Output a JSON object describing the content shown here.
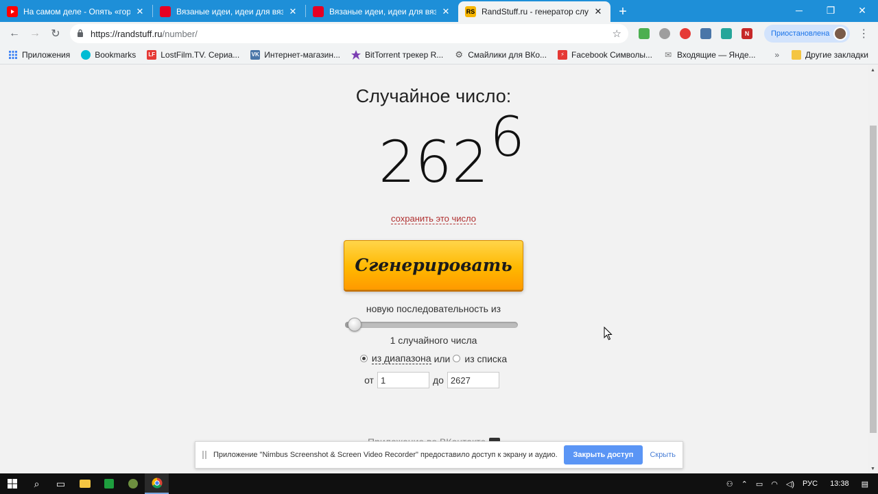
{
  "browser": {
    "tabs": [
      {
        "title": "На самом деле - Опять «гор",
        "favicon": "youtube-icon",
        "color": "#ff0000",
        "active": false
      },
      {
        "title": "Вязаные идеи, идеи для вязан",
        "favicon": "pinterest-icon",
        "color": "#e60023",
        "active": false
      },
      {
        "title": "Вязаные идеи, идеи для вязан",
        "favicon": "pinterest-icon",
        "color": "#e60023",
        "active": false
      },
      {
        "title": "RandStuff.ru - генератор случа",
        "favicon": "randstuff-icon",
        "color": "#f7b500",
        "favicon_text": "RS",
        "active": true
      }
    ],
    "close_glyph": "✕",
    "new_tab_glyph": "+",
    "address": {
      "host": "https://randstuff.ru",
      "path": "/number/"
    },
    "profile_status": "Приостановлена",
    "bookmarks": [
      {
        "label": "Приложения",
        "icon": "apps-grid-icon",
        "color": "#4285f4"
      },
      {
        "label": "Bookmarks",
        "icon": "bookmarks-icon",
        "color": "#00bcd4"
      },
      {
        "label": "LostFilm.TV. Сериа...",
        "icon": "lostfilm-icon",
        "color": "#e53935",
        "text": "LF"
      },
      {
        "label": "Интернет-магазин...",
        "icon": "vk-icon",
        "color": "#4a76a8",
        "text": "VK"
      },
      {
        "label": "BitTorrent трекер R...",
        "icon": "bittorrent-icon",
        "color": "#7b3fb2"
      },
      {
        "label": "Смайлики для ВКо...",
        "icon": "gear-icon",
        "color": "#555555"
      },
      {
        "label": "Facebook Символы...",
        "icon": "facebook-symbols-icon",
        "color": "#e53935"
      },
      {
        "label": "Входящие — Янде...",
        "icon": "mail-icon",
        "color": "#888888"
      }
    ],
    "bookmarks_more": "»",
    "other_bookmarks": "Другие закладки"
  },
  "page": {
    "title": "Случайное число:",
    "number": "262",
    "number_ghost": "6",
    "save_link": "сохранить это число",
    "generate_button": "Сгенерировать",
    "sequence_label": "новую последовательность из",
    "slider_fraction": 0.03,
    "count_label": "1 случайного числа",
    "mode_range": "из диапазона",
    "mode_or": "или",
    "mode_list": "из списка",
    "from_label": "от",
    "from_value": "1",
    "to_label": "до",
    "to_value": "2627",
    "vk_link": "Приложение во ВКонтакте"
  },
  "share_bar": {
    "message": "Приложение \"Nimbus Screenshot & Screen Video Recorder\" предоставило доступ к экрану и аудио.",
    "stop_button": "Закрыть доступ",
    "hide_link": "Скрыть"
  },
  "taskbar": {
    "language": "РУС",
    "time": "13:38"
  }
}
